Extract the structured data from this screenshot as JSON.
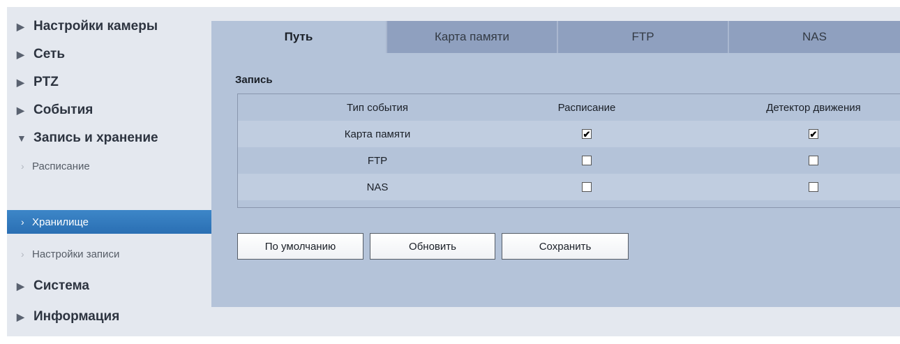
{
  "sidebar": {
    "items": [
      {
        "label": "Настройки камеры"
      },
      {
        "label": "Сеть"
      },
      {
        "label": "PTZ"
      },
      {
        "label": "События"
      },
      {
        "label": "Запись и хранение"
      },
      {
        "label": "Расписание"
      },
      {
        "label": "Хранилище"
      },
      {
        "label": "Настройки записи"
      },
      {
        "label": "Система"
      },
      {
        "label": "Информация"
      }
    ],
    "collapsed_arrow": "▶",
    "expanded_arrow": "▼",
    "sub_chevron": "›"
  },
  "tabs": [
    {
      "label": "Путь"
    },
    {
      "label": "Карта памяти"
    },
    {
      "label": "FTP"
    },
    {
      "label": "NAS"
    }
  ],
  "section": {
    "title": "Запись"
  },
  "table": {
    "headers": [
      "Тип события",
      "Расписание",
      "Детектор движения"
    ],
    "rows": [
      {
        "label": "Карта памяти",
        "schedule": true,
        "motion": true
      },
      {
        "label": "FTP",
        "schedule": false,
        "motion": false
      },
      {
        "label": "NAS",
        "schedule": false,
        "motion": false
      }
    ]
  },
  "buttons": {
    "default": "По умолчанию",
    "refresh": "Обновить",
    "save": "Сохранить"
  },
  "colors": {
    "active_nav": "#2a6fb3",
    "tab_inactive": "#8fa0bf",
    "panel": "#b4c3d9"
  }
}
